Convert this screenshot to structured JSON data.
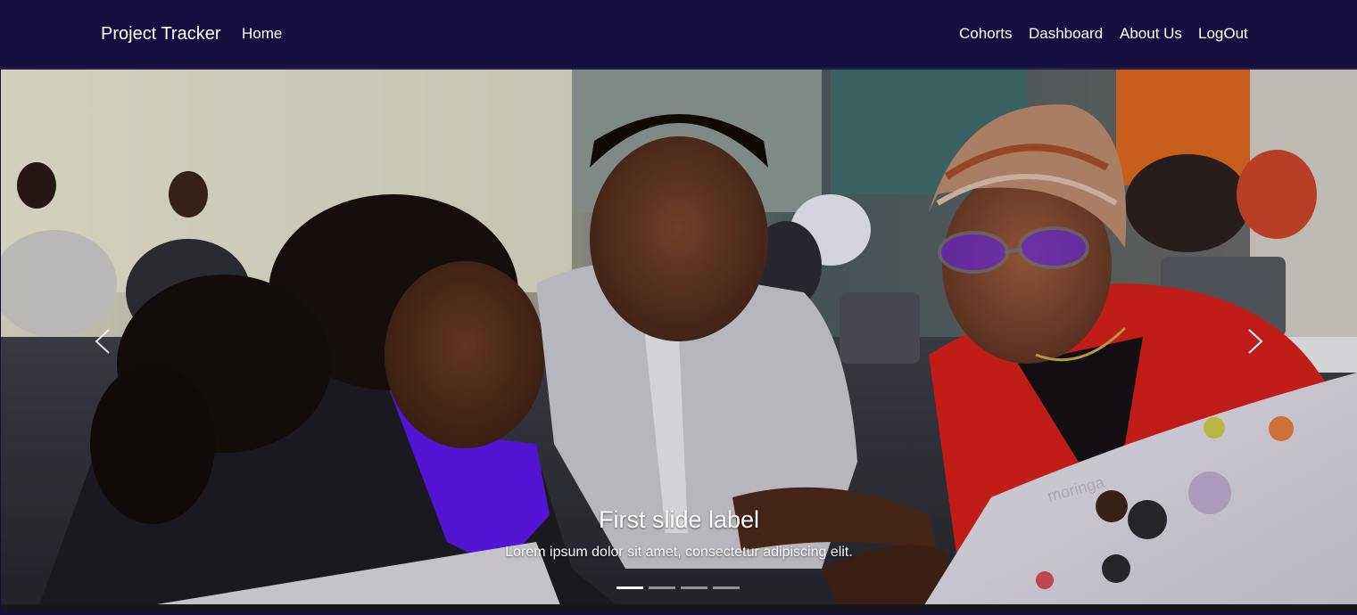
{
  "navbar": {
    "brand": "Project Tracker",
    "home": "Home",
    "links": [
      "Cohorts",
      "Dashboard",
      "About Us",
      "LogOut"
    ],
    "background": "#150f40"
  },
  "carousel": {
    "active_index": 0,
    "slide_count": 4,
    "caption_title": "First slide label",
    "caption_text": "Lorem ipsum dolor sit amet, consectetur adipiscing elit.",
    "prev_icon": "chevron-left-icon",
    "next_icon": "chevron-right-icon",
    "image_text": "moringa"
  }
}
